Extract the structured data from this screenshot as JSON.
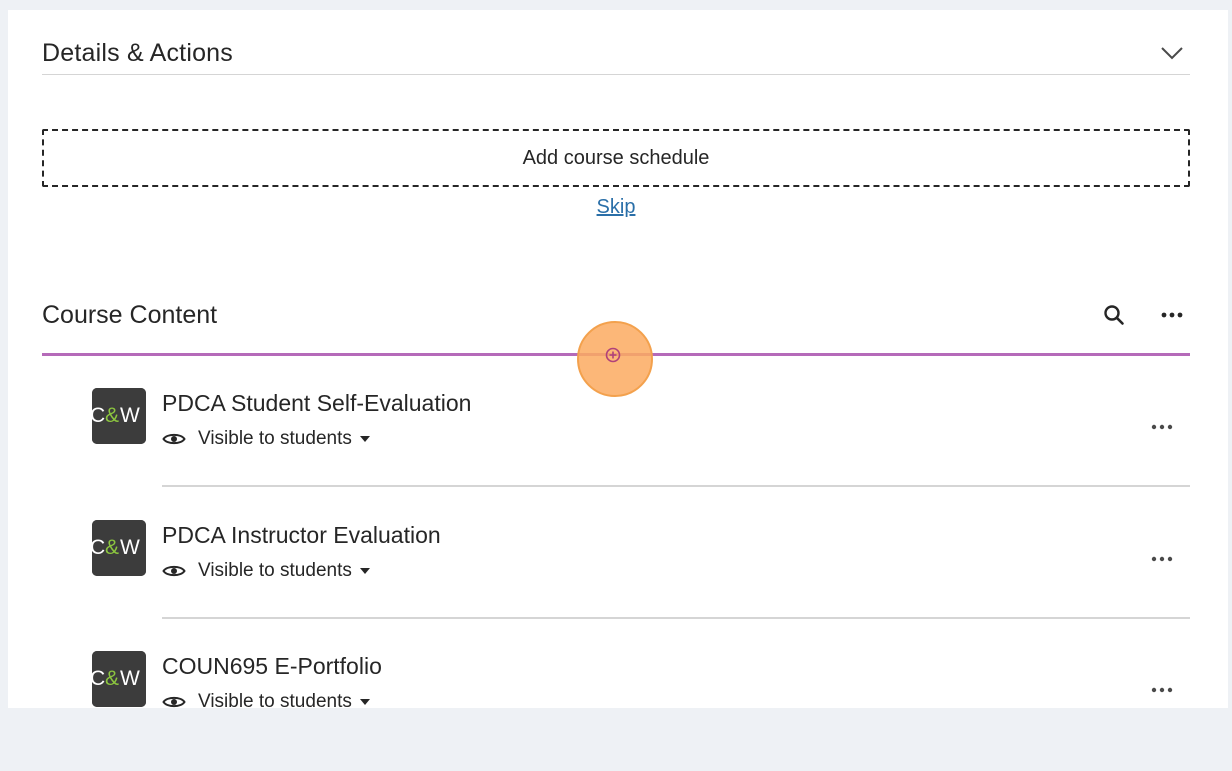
{
  "details": {
    "title": "Details & Actions"
  },
  "schedule": {
    "add_label": "Add course schedule",
    "skip_label": "Skip"
  },
  "course_content": {
    "title": "Course Content",
    "items": [
      {
        "logo": "C&W",
        "title": "PDCA Student Self-Evaluation",
        "visibility": "Visible to students"
      },
      {
        "logo": "C&W",
        "title": "PDCA Instructor Evaluation",
        "visibility": "Visible to students"
      },
      {
        "logo": "C&W",
        "title": "COUN695 E-Portfolio",
        "visibility": "Visible to students"
      }
    ]
  },
  "icons": {
    "collapse": "chevron-down-icon",
    "search": "search-icon",
    "more": "more-horizontal-icon",
    "insert": "plus-circle-icon",
    "visibility": "eye-icon",
    "dropdown": "caret-down-icon"
  },
  "colors": {
    "insert_line": "#b56ab9",
    "click_highlight": "#fbaa60",
    "link": "#2a6fa8",
    "logo_accent": "#8cc63f"
  }
}
